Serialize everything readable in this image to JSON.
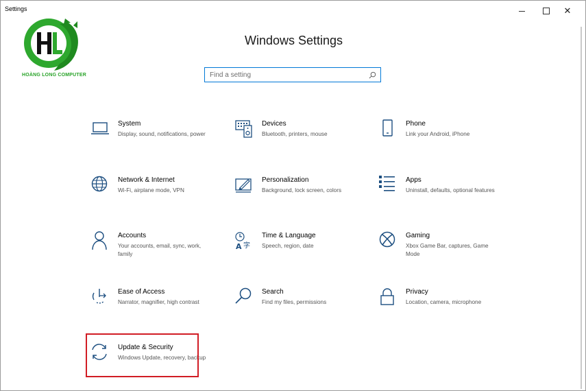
{
  "window": {
    "title": "Settings",
    "minimize_label": "Minimize",
    "maximize_label": "Maximize",
    "close_label": "✕"
  },
  "logo": {
    "text": "HOÀNG LONG COMPUTER",
    "colors": {
      "green": "#2ea82e",
      "dark": "#111111"
    }
  },
  "page": {
    "heading": "Windows Settings"
  },
  "search": {
    "placeholder": "Find a setting",
    "value": ""
  },
  "colors": {
    "accent": "#0078d7",
    "highlight": "#d11c24"
  },
  "tiles": [
    {
      "title": "System",
      "desc": "Display, sound, notifications, power",
      "icon": "laptop-icon"
    },
    {
      "title": "Devices",
      "desc": "Bluetooth, printers, mouse",
      "icon": "devices-icon"
    },
    {
      "title": "Phone",
      "desc": "Link your Android, iPhone",
      "icon": "phone-icon"
    },
    {
      "title": "Network & Internet",
      "desc": "Wi-Fi, airplane mode, VPN",
      "icon": "globe-icon"
    },
    {
      "title": "Personalization",
      "desc": "Background, lock screen, colors",
      "icon": "paint-icon"
    },
    {
      "title": "Apps",
      "desc": "Uninstall, defaults, optional features",
      "icon": "apps-list-icon"
    },
    {
      "title": "Accounts",
      "desc": "Your accounts, email, sync, work, family",
      "icon": "person-icon"
    },
    {
      "title": "Time & Language",
      "desc": "Speech, region, date",
      "icon": "time-language-icon"
    },
    {
      "title": "Gaming",
      "desc": "Xbox Game Bar, captures, Game Mode",
      "icon": "xbox-icon"
    },
    {
      "title": "Ease of Access",
      "desc": "Narrator, magnifier, high contrast",
      "icon": "ease-of-access-icon"
    },
    {
      "title": "Search",
      "desc": "Find my files, permissions",
      "icon": "search-icon"
    },
    {
      "title": "Privacy",
      "desc": "Location, camera, microphone",
      "icon": "lock-icon"
    },
    {
      "title": "Update & Security",
      "desc": "Windows Update, recovery, backup",
      "icon": "sync-icon"
    }
  ]
}
